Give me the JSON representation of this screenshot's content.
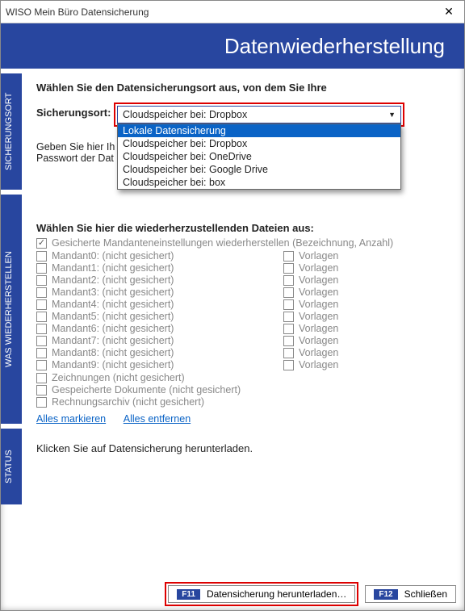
{
  "title": "WISO Mein Büro Datensicherung",
  "banner": "Datenwiederherstellung",
  "tabs": {
    "t1": "SICHERUNGSORT",
    "t2": "WAS WIEDERHERSTELLEN",
    "t3": "STATUS"
  },
  "s1": {
    "intro": "Wählen Sie den Datensicherungsort aus, von dem Sie Ihre",
    "loc_label": "Sicherungsort:",
    "selected": "Cloudspeicher bei: Dropbox",
    "options": [
      "Lokale Datensicherung",
      "Cloudspeicher bei: Dropbox",
      "Cloudspeicher bei: OneDrive",
      "Cloudspeicher bei: Google Drive",
      "Cloudspeicher bei: box"
    ],
    "hint1": "Geben Sie hier Ih",
    "hint2": "Passwort der Dat"
  },
  "s2": {
    "head": "Wählen Sie hier die wiederherzustellenden Dateien aus:",
    "mand_restore": "Gesicherte Mandanteneinstellungen wiederherstellen (Bezeichnung, Anzahl)",
    "mandants": [
      "Mandant0: (nicht gesichert)",
      "Mandant1: (nicht gesichert)",
      "Mandant2: (nicht gesichert)",
      "Mandant3: (nicht gesichert)",
      "Mandant4: (nicht gesichert)",
      "Mandant5: (nicht gesichert)",
      "Mandant6: (nicht gesichert)",
      "Mandant7: (nicht gesichert)",
      "Mandant8: (nicht gesichert)",
      "Mandant9: (nicht gesichert)"
    ],
    "vorlagen": "Vorlagen",
    "extra": [
      "Zeichnungen (nicht gesichert)",
      "Gespeicherte Dokumente (nicht gesichert)",
      "Rechnungsarchiv (nicht gesichert)"
    ],
    "link_all": "Alles markieren",
    "link_none": "Alles entfernen"
  },
  "s3": {
    "text": "Klicken Sie auf Datensicherung herunterladen."
  },
  "footer": {
    "f11": "F11",
    "download": "Datensicherung herunterladen…",
    "f12": "F12",
    "close": "Schließen"
  }
}
